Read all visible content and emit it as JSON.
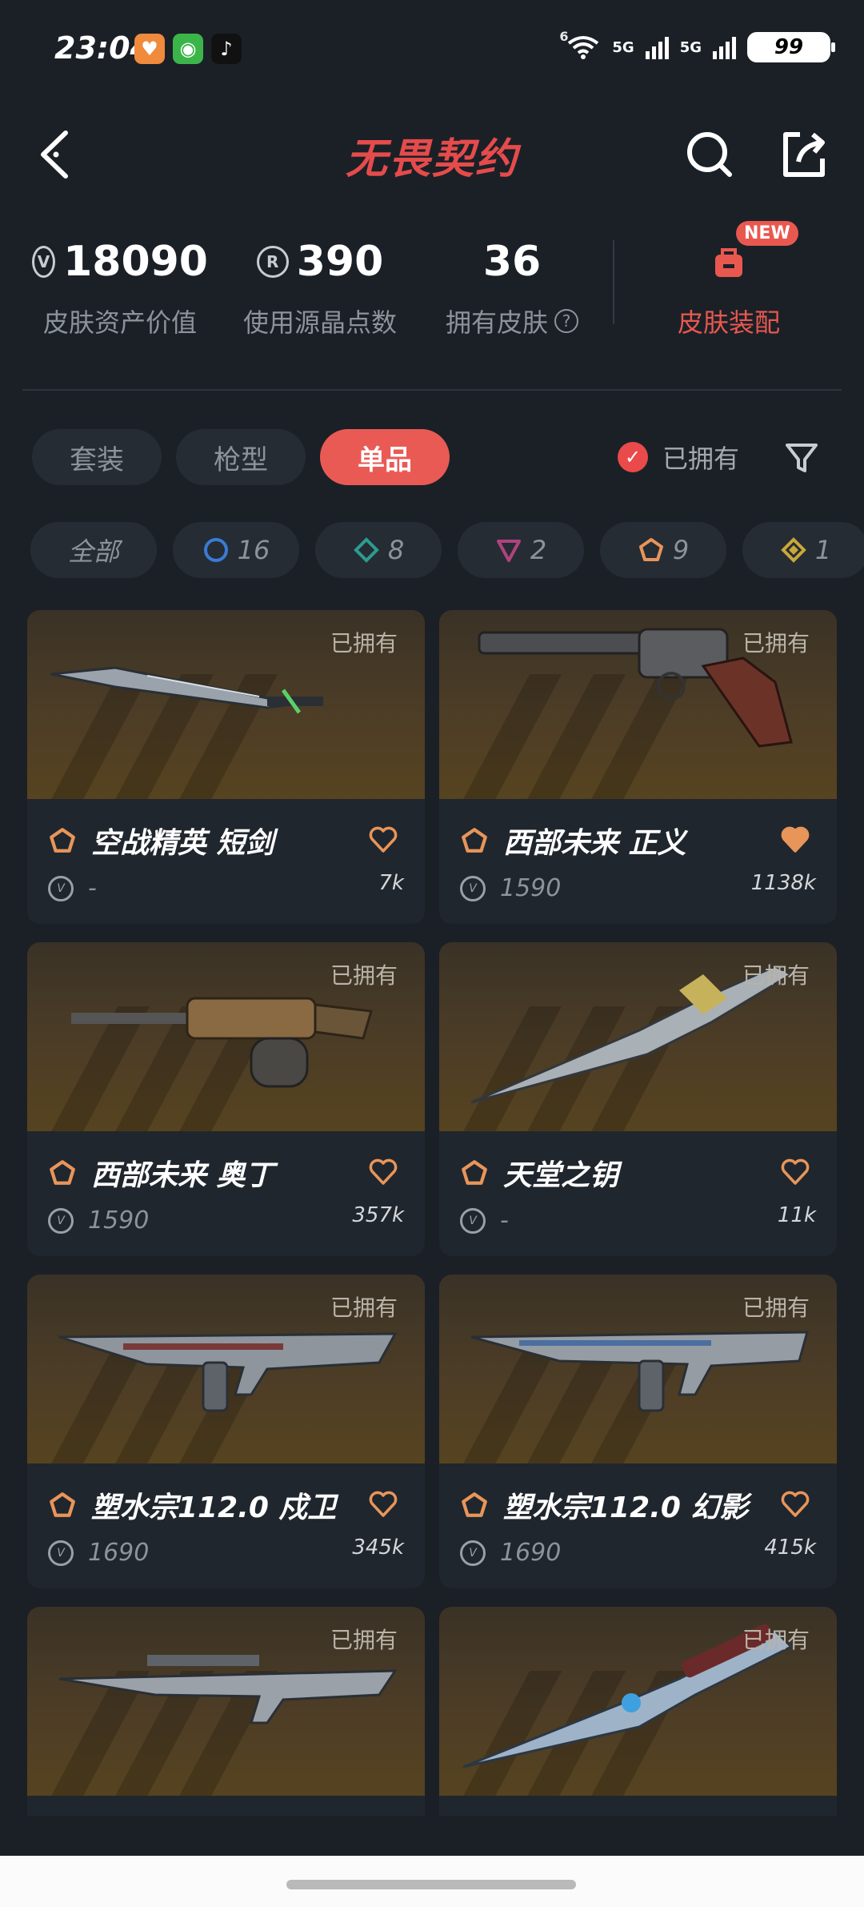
{
  "status_bar": {
    "time": "23:04",
    "network_1": "5G",
    "network_2": "5G",
    "wifi_badge": "6",
    "battery": "99"
  },
  "header": {
    "title": "无畏契约"
  },
  "stats": {
    "asset_value": "18090",
    "asset_value_label": "皮肤资产价值",
    "radianite_points": "390",
    "radianite_points_label": "使用源晶点数",
    "owned_skins": "36",
    "owned_skins_label": "拥有皮肤",
    "equip_label": "皮肤装配",
    "new_badge": "NEW"
  },
  "tabs": [
    {
      "label": "套装",
      "active": false
    },
    {
      "label": "枪型",
      "active": false
    },
    {
      "label": "单品",
      "active": true
    }
  ],
  "owned_filter": {
    "label": "已拥有",
    "checked": true
  },
  "rarity_chips": [
    {
      "label": "全部",
      "icon": "",
      "color": ""
    },
    {
      "label": "16",
      "icon": "select-tier-icon",
      "color": "#3a7bd5"
    },
    {
      "label": "8",
      "icon": "deluxe-tier-icon",
      "color": "#2a9d8f"
    },
    {
      "label": "2",
      "icon": "premium-tier-icon",
      "color": "#b0427d"
    },
    {
      "label": "9",
      "icon": "exclusive-tier-icon",
      "color": "#e8955a"
    },
    {
      "label": "1",
      "icon": "ultra-tier-icon",
      "color": "#c9a83a"
    }
  ],
  "skins": [
    {
      "name": "空战精英 短剑",
      "price": "-",
      "likes": "7k",
      "owned_tag": "已拥有",
      "liked": false,
      "weapon": "knife"
    },
    {
      "name": "西部未来 正义",
      "price": "1590",
      "likes": "1138k",
      "owned_tag": "已拥有",
      "liked": true,
      "weapon": "revolver"
    },
    {
      "name": "西部未来 奥丁",
      "price": "1590",
      "likes": "357k",
      "owned_tag": "已拥有",
      "liked": false,
      "weapon": "machinegun"
    },
    {
      "name": "天堂之钥",
      "price": "-",
      "likes": "11k",
      "owned_tag": "已拥有",
      "liked": false,
      "weapon": "dagger"
    },
    {
      "name": "塑水宗112.0 戍卫",
      "price": "1690",
      "likes": "345k",
      "owned_tag": "已拥有",
      "liked": false,
      "weapon": "rifle"
    },
    {
      "name": "塑水宗112.0 幻影",
      "price": "1690",
      "likes": "415k",
      "owned_tag": "已拥有",
      "liked": false,
      "weapon": "rifle2"
    },
    {
      "name": "",
      "price": "",
      "likes": "",
      "owned_tag": "已拥有",
      "liked": false,
      "weapon": "sniper"
    },
    {
      "name": "",
      "price": "",
      "likes": "",
      "owned_tag": "已拥有",
      "liked": false,
      "weapon": "blade"
    }
  ],
  "colors": {
    "accent": "#ea5a55",
    "background": "#1b2027",
    "exclusive_tier": "#e8955a"
  }
}
